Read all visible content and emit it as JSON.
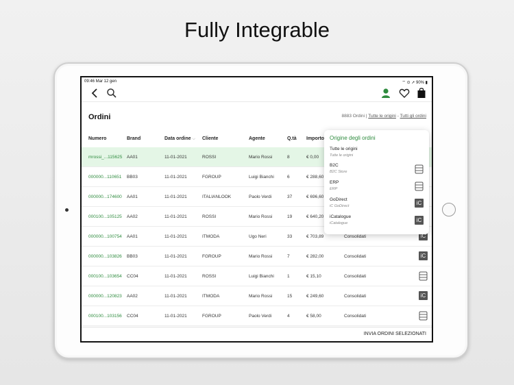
{
  "headline": "Fully Integrable",
  "status": {
    "time_date": "09:46  Mar 12 gen",
    "right": "⌔ ⊙ ➚ 90% ▮"
  },
  "page": {
    "title": "Ordini"
  },
  "filter": {
    "count": "8883 Ordini",
    "separator1": "|",
    "origin_link": "Tutte le origini",
    "separator2": "-",
    "orders_link": "Tutti gli ordini"
  },
  "table": {
    "columns": {
      "numero": "Numero",
      "brand": "Brand",
      "data": "Data ordine",
      "data_sort": "⌵",
      "cliente": "Cliente",
      "agente": "Agente",
      "qta": "Q.tà",
      "importo": "Importo"
    },
    "rows": [
      {
        "numero": "mrossi_...115625",
        "brand": "AA01",
        "data": "11-01-2021",
        "cliente": "ROSSI",
        "agente": "Mario Rossi",
        "qta": "8",
        "importo": "€ 0,00",
        "stato": "",
        "origin": "none",
        "selected": true
      },
      {
        "numero": "000000...110651",
        "brand": "BB03",
        "data": "11-01-2021",
        "cliente": "FGROUP",
        "agente": "Luigi Bianchi",
        "qta": "6",
        "importo": "€ 288,60",
        "stato": "",
        "origin": "none"
      },
      {
        "numero": "000000...174600",
        "brand": "AA01",
        "data": "11-01-2021",
        "cliente": "ITALIANLOOK",
        "agente": "Paolo Verdi",
        "qta": "37",
        "importo": "€ 696,60",
        "stato": "",
        "origin": "none"
      },
      {
        "numero": "000100...105125",
        "brand": "AA02",
        "data": "11-01-2021",
        "cliente": "ROSSI",
        "agente": "Mario Rossi",
        "qta": "19",
        "importo": "€ 640,20",
        "stato": "",
        "origin": "none"
      },
      {
        "numero": "000000...100754",
        "brand": "AA01",
        "data": "11-01-2021",
        "cliente": "ITMODA",
        "agente": "Ugo Neri",
        "qta": "33",
        "importo": "€ 703,89",
        "stato": "Consolidati",
        "origin": "ic"
      },
      {
        "numero": "000000...103826",
        "brand": "BB03",
        "data": "11-01-2021",
        "cliente": "FGROUP",
        "agente": "Mario Rossi",
        "qta": "7",
        "importo": "€ 282,00",
        "stato": "Consolidati",
        "origin": "ic"
      },
      {
        "numero": "000100...103654",
        "brand": "CC04",
        "data": "11-01-2021",
        "cliente": "ROSSI",
        "agente": "Luigi Bianchi",
        "qta": "1",
        "importo": "€ 15,10",
        "stato": "Consolidati",
        "origin": "server"
      },
      {
        "numero": "000000...120823",
        "brand": "AA02",
        "data": "11-01-2021",
        "cliente": "ITMODA",
        "agente": "Mario Rossi",
        "qta": "15",
        "importo": "€ 249,60",
        "stato": "Consolidati",
        "origin": "ic"
      },
      {
        "numero": "000100...103156",
        "brand": "CC04",
        "data": "11-01-2021",
        "cliente": "FGROUP",
        "agente": "Paolo Verdi",
        "qta": "4",
        "importo": "€ 58,00",
        "stato": "Consolidati",
        "origin": "server"
      }
    ]
  },
  "popover": {
    "title": "Origine degli ordini",
    "items": [
      {
        "label": "Tutte le origini",
        "sub": "Tutte le origini",
        "icon": "none"
      },
      {
        "label": "B2C",
        "sub": "B2C Store",
        "icon": "server"
      },
      {
        "label": "ERP",
        "sub": "ERP",
        "icon": "server"
      },
      {
        "label": "GoDirect",
        "sub": "iC GoDirect",
        "icon": "ic"
      },
      {
        "label": "iCatalogue",
        "sub": "iCatalogue",
        "icon": "ic"
      }
    ],
    "ic_text": "iC"
  },
  "bottom": {
    "send_label": "INVIA ORDINI SELEZIONATI"
  },
  "colors": {
    "accent": "#2e8b3e",
    "selected_row": "#e4f6e6"
  }
}
